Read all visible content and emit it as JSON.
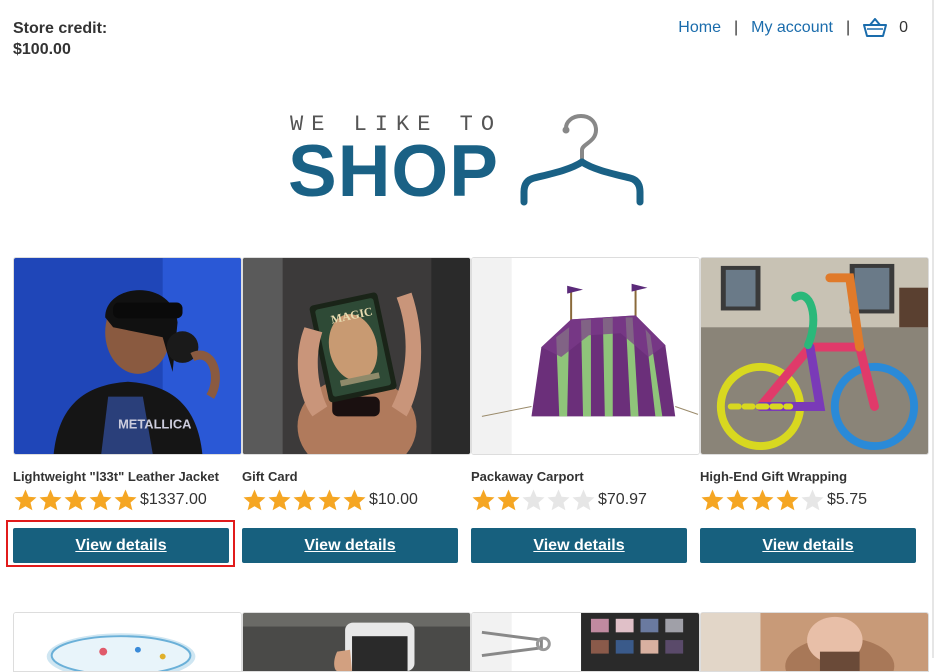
{
  "header": {
    "store_credit_label": "Store credit:",
    "store_credit_value": "$100.00",
    "nav": {
      "home": "Home",
      "separator": "|",
      "my_account": "My account",
      "cart_count": "0"
    }
  },
  "logo": {
    "tagline": "WE LIKE TO",
    "word": "SHOP",
    "icon": "hanger-icon"
  },
  "products": [
    {
      "name": "Lightweight \"l33t\" Leather Jacket",
      "rating": 5,
      "price": "$1337.00",
      "button": "View details",
      "image": "woman-with-headphones"
    },
    {
      "name": "Gift Card",
      "rating": 5,
      "price": "$10.00",
      "button": "View details",
      "image": "hand-holding-card"
    },
    {
      "name": "Packaway Carport",
      "rating": 2,
      "price": "$70.97",
      "button": "View details",
      "image": "striped-tent"
    },
    {
      "name": "High-End Gift Wrapping",
      "rating": 4,
      "price": "$5.75",
      "button": "View details",
      "image": "knitted-bicycle"
    }
  ],
  "colors": {
    "link": "#1a6cac",
    "button": "#17607e",
    "star_on": "#f5a623",
    "star_off": "#e6e6e6",
    "highlight": "#e11b1b",
    "logo": "#1a6185"
  }
}
